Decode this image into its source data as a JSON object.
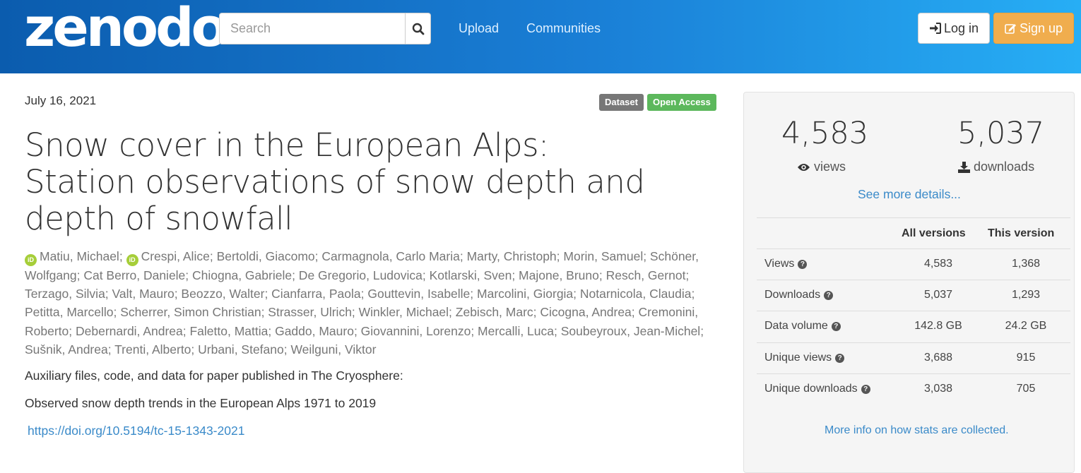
{
  "header": {
    "logo_text": "zenodo",
    "search_placeholder": "Search",
    "nav": [
      "Upload",
      "Communities"
    ],
    "login_label": "Log in",
    "signup_label": "Sign up"
  },
  "record": {
    "date": "July 16, 2021",
    "badges": [
      "Dataset",
      "Open Access"
    ],
    "title": "Snow cover in the European Alps: Station observations of snow depth and depth of snowfall",
    "authors_orcid": [
      "Matiu, Michael",
      "Crespi, Alice"
    ],
    "authors_rest": "Bertoldi, Giacomo; Carmagnola, Carlo Maria; Marty, Christoph; Morin, Samuel; Schöner, Wolfgang; Cat Berro, Daniele; Chiogna, Gabriele; De Gregorio, Ludovica; Kotlarski, Sven; Majone, Bruno; Resch, Gernot; Terzago, Silvia; Valt, Mauro; Beozzo, Walter; Cianfarra, Paola; Gouttevin, Isabelle; Marcolini, Giorgia; Notarnicola, Claudia; Petitta, Marcello; Scherrer, Simon Christian; Strasser, Ulrich; Winkler, Michael; Zebisch, Marc; Cicogna, Andrea; Cremonini, Roberto; Debernardi, Andrea; Faletto, Mattia; Gaddo, Mauro; Giovannini, Lorenzo; Mercalli, Luca; Soubeyroux, Jean-Michel; Sušnik, Andrea; Trenti, Alberto; Urbani, Stefano; Weilguni, Viktor",
    "description_1": "Auxiliary files, code, and data for paper published in The Cryosphere:",
    "description_2": "Observed snow depth trends in the European Alps 1971 to 2019",
    "doi_link": "https://doi.org/10.5194/tc-15-1343-2021"
  },
  "stats": {
    "views": "4,583",
    "views_label": "views",
    "downloads": "5,037",
    "downloads_label": "downloads",
    "see_more": "See more details...",
    "columns": [
      "All versions",
      "This version"
    ],
    "rows": [
      {
        "label": "Views",
        "all": "4,583",
        "this": "1,368"
      },
      {
        "label": "Downloads",
        "all": "5,037",
        "this": "1,293"
      },
      {
        "label": "Data volume",
        "all": "142.8 GB",
        "this": "24.2 GB"
      },
      {
        "label": "Unique views",
        "all": "3,688",
        "this": "915"
      },
      {
        "label": "Unique downloads",
        "all": "3,038",
        "this": "705"
      }
    ],
    "more_info": "More info on how stats are collected."
  },
  "colors": {
    "header_start": "#0b5cae",
    "header_end": "#27aef5",
    "link": "#3a8ac9",
    "open_access": "#5cb85c",
    "dataset_badge": "#777777",
    "signup": "#f0ad4e",
    "orcid": "#a6ce39"
  }
}
